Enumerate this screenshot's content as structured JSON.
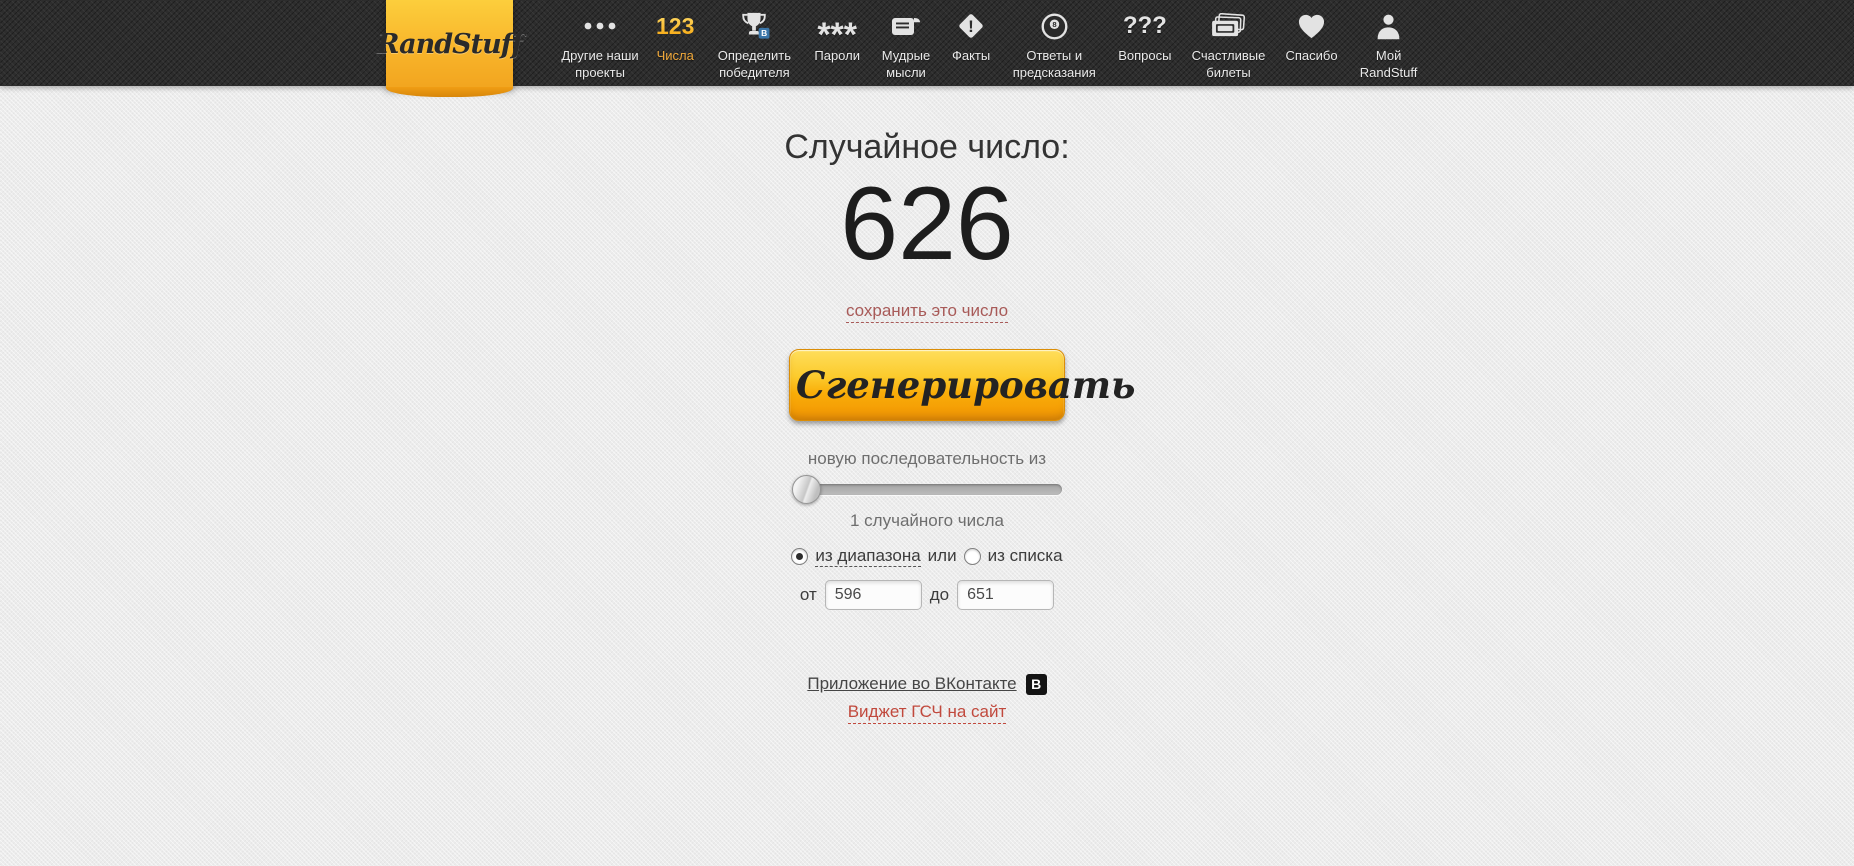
{
  "header": {
    "logo_text": "RandStuff",
    "vk_badge_letter": "В",
    "nav_items": [
      {
        "label": "Другие наши проекты",
        "icon": "dots-icon",
        "active": false
      },
      {
        "label": "Числа",
        "icon": "numbers-123-icon",
        "icon_text": "123",
        "active": true
      },
      {
        "label": "Определить победителя",
        "icon": "trophy-vk-icon",
        "active": false
      },
      {
        "label": "Пароли",
        "icon": "asterisks-icon",
        "icon_text": "***",
        "active": false
      },
      {
        "label": "Мудрые мысли",
        "icon": "scroll-icon",
        "active": false
      },
      {
        "label": "Факты",
        "icon": "exclamation-diamond-icon",
        "icon_text": "!",
        "active": false
      },
      {
        "label": "Ответы и предсказания",
        "icon": "eight-ball-icon",
        "icon_text": "8",
        "active": false
      },
      {
        "label": "Вопросы",
        "icon": "question-marks-icon",
        "icon_text": "???",
        "active": false
      },
      {
        "label": "Счастливые билеты",
        "icon": "tickets-icon",
        "active": false
      },
      {
        "label": "Спасибо",
        "icon": "heart-icon",
        "active": false
      },
      {
        "label": "Мой RandStuff",
        "icon": "user-icon",
        "active": false
      }
    ]
  },
  "main": {
    "heading": "Случайное число:",
    "number": "626",
    "save_link": "сохранить это число",
    "generate_button": "Сгенерировать",
    "sequence_label": "новую последовательность из",
    "count_label": "1 случайного числа",
    "options": {
      "range_label": "из диапазона",
      "or_label": "или",
      "list_label": "из списка",
      "selected": "из диапазона"
    },
    "range": {
      "from_label": "от",
      "from_value": "596",
      "to_label": "до",
      "to_value": "651"
    }
  },
  "footer": {
    "vk_app_link": "Приложение во ВКонтакте",
    "vk_icon_letter": "В",
    "widget_link": "Виджет ГСЧ на сайт"
  },
  "colors": {
    "header_bg": "#2d2d2d",
    "page_bg": "#ececec",
    "ribbon_orange": "#f8b52b",
    "active_nav": "#f0a93c",
    "button_orange": "#f9ad08",
    "save_link_red": "#a85a58",
    "widget_link_red": "#c1493d",
    "vk_blue": "#3a75a8"
  }
}
